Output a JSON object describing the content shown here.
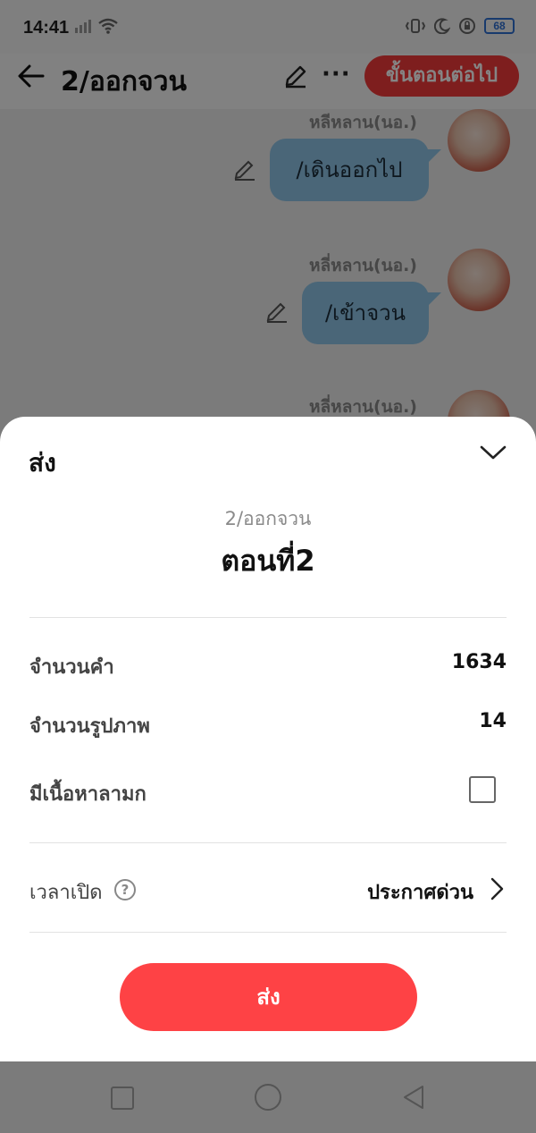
{
  "status_bar": {
    "time": "14:41",
    "battery": "68"
  },
  "header": {
    "title": "2/ออกจวน",
    "next_button": "ขั้นตอนต่อไป",
    "back_icon": "arrow-left-icon",
    "edit_icon": "pencil-icon",
    "more_icon": "more-horizontal-icon",
    "more_label": "···"
  },
  "chat": {
    "messages": [
      {
        "name": "หลีหลาน(นอ.)",
        "text": "/เดินออกไป"
      },
      {
        "name": "หลี่หลาน(นอ.)",
        "text": "/เข้าจวน"
      },
      {
        "name": "หลี่หลาน(นอ.)",
        "text": ""
      }
    ]
  },
  "sheet": {
    "title": "ส่ง",
    "series": "2/ออกจวน",
    "episode": "ตอนที่2",
    "word_count_label": "จำนวนคำ",
    "word_count": "1634",
    "image_count_label": "จำนวนรูปภาพ",
    "image_count": "14",
    "adult_label": "มีเนื้อหาลามก",
    "adult_checked": false,
    "publish_time_label": "เวลาเปิด",
    "help_mark": "?",
    "publish_time_value": "ประกาศด่วน",
    "submit_label": "ส่ง"
  },
  "colors": {
    "accent": "#fe4245",
    "bubble": "#8fc3e6"
  }
}
